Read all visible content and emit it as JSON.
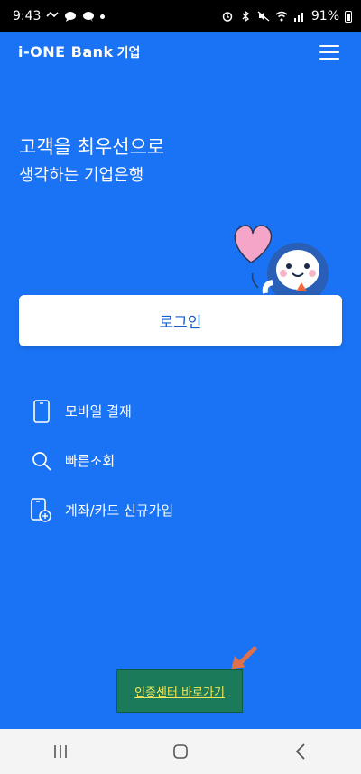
{
  "status": {
    "time": "9:43",
    "battery": "91%"
  },
  "header": {
    "brand": "i-ONE Bank",
    "sub": "기업"
  },
  "hero": {
    "line1": "고객을 최우선으로",
    "line2": "생각하는 기업은행"
  },
  "login": {
    "label": "로그인"
  },
  "menu": [
    {
      "label": "모바일 결재",
      "icon": "mobile-phone-icon"
    },
    {
      "label": "빠른조회",
      "icon": "search-icon"
    },
    {
      "label": "계좌/카드 신규가입",
      "icon": "phone-add-icon"
    }
  ],
  "cert": {
    "label": "인증센터 바로가기"
  },
  "colors": {
    "background": "#1a73f5",
    "cert_bg": "#1b7a5a",
    "cert_text": "#f2e95a",
    "arrow": "#e0724a"
  }
}
